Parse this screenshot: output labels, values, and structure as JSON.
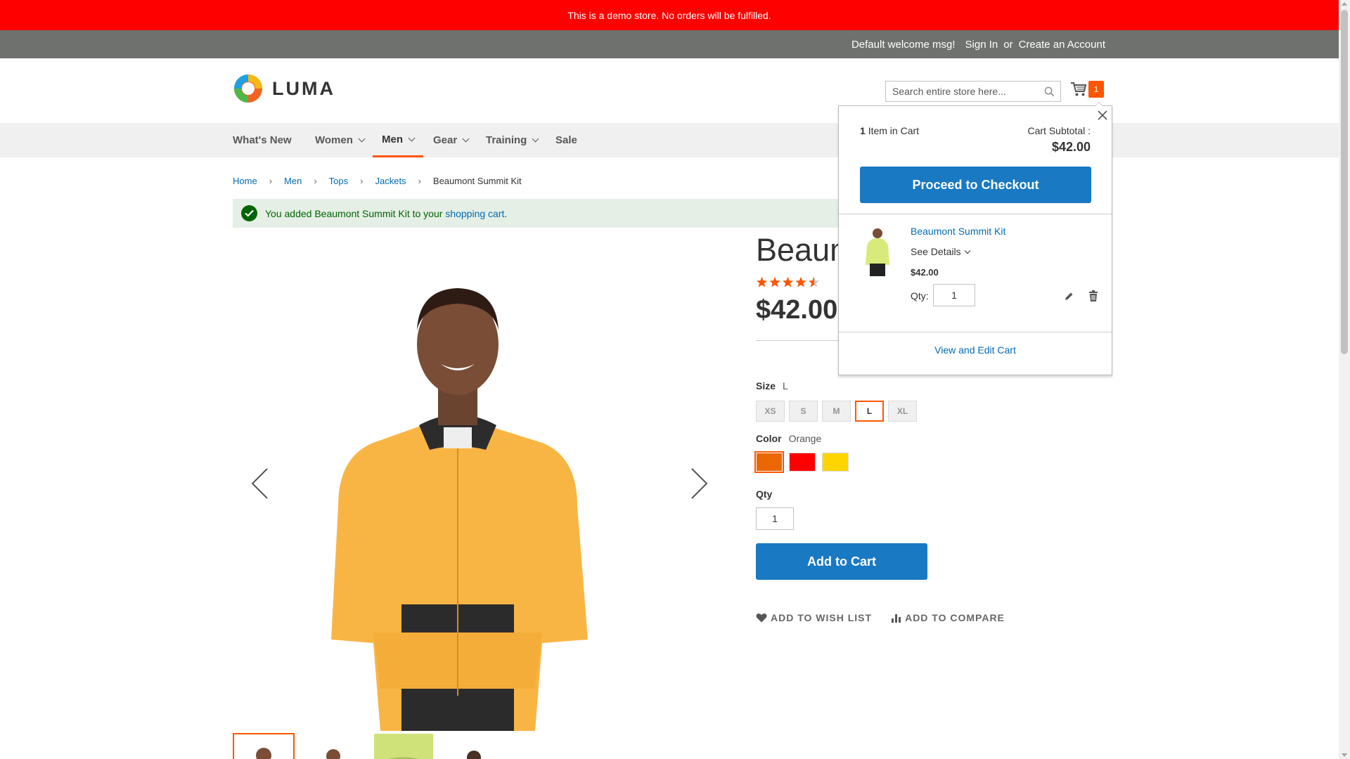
{
  "demo_notice": "This is a demo store. No orders will be fulfilled.",
  "header_links": {
    "welcome": "Default welcome msg!",
    "sign_in": "Sign In",
    "or": "or",
    "create_account": "Create an Account"
  },
  "logo_text": "LUMA",
  "search": {
    "placeholder": "Search entire store here..."
  },
  "cart_count": "1",
  "nav": {
    "items": [
      {
        "label": "What's New"
      },
      {
        "label": "Women"
      },
      {
        "label": "Men"
      },
      {
        "label": "Gear"
      },
      {
        "label": "Training"
      },
      {
        "label": "Sale"
      }
    ],
    "active": "Men"
  },
  "breadcrumb": [
    {
      "label": "Home"
    },
    {
      "label": "Men"
    },
    {
      "label": "Tops"
    },
    {
      "label": "Jackets"
    },
    {
      "label": "Beaumont Summit Kit"
    }
  ],
  "message": {
    "prefix": "You added Beaumont Summit Kit to your ",
    "link": "shopping cart",
    "suffix": "."
  },
  "product": {
    "title_visible": "Beaum",
    "rating_percent": 90,
    "price": "$42.00",
    "size_label": "Size",
    "size_selected": "L",
    "sizes": [
      "XS",
      "S",
      "M",
      "L",
      "XL"
    ],
    "color_label": "Color",
    "color_selected": "Orange",
    "colors": [
      "#eb6703",
      "#ff0000",
      "#ffd500"
    ],
    "qty_label": "Qty",
    "qty_value": "1",
    "add_to_cart": "Add to Cart",
    "wishlist": "ADD TO WISH LIST",
    "compare": "ADD TO COMPARE"
  },
  "minicart": {
    "count": "1",
    "count_label": "Item in Cart",
    "subtotal_label": "Cart Subtotal :",
    "subtotal": "$42.00",
    "checkout": "Proceed to Checkout",
    "item_name": "Beaumont Summit Kit",
    "see_details": "See Details",
    "item_price": "$42.00",
    "qty_label": "Qty:",
    "qty_value": "1",
    "view_edit": "View and Edit Cart"
  },
  "colors": {
    "accent": "#ff5501",
    "primary": "#1979c3",
    "link": "#006bb4",
    "demo_bar": "#ff0000",
    "header_bar": "#6e716e"
  }
}
